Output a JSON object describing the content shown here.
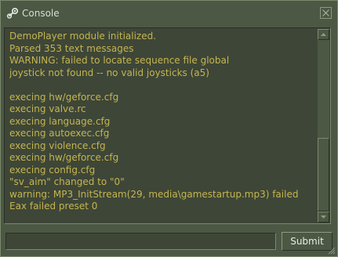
{
  "window": {
    "title": "Console",
    "title_icon": "steam-logo-icon",
    "close_icon": "close-icon"
  },
  "output": {
    "lines": [
      "DemoPlayer module initialized.",
      "Parsed 353 text messages",
      "WARNING: failed to locate sequence file global",
      "joystick not found -- no valid joysticks (a5)",
      "",
      "execing hw/geforce.cfg",
      "execing valve.rc",
      "execing language.cfg",
      "execing autoexec.cfg",
      "execing violence.cfg",
      "execing hw/geforce.cfg",
      "execing config.cfg",
      "\"sv_aim\" changed to \"0\"",
      "warning: MP3_InitStream(29, media\\gamestartup.mp3) failed",
      "Eax failed preset 0"
    ],
    "text_color": "#c4b550",
    "scroll_position": 1.0
  },
  "command": {
    "value": "",
    "placeholder": ""
  },
  "submit": {
    "label": "Submit"
  },
  "colors": {
    "window_bg": "#4c5844",
    "panel_bg": "#3e4637",
    "highlight": "#7b8a6e",
    "shadow": "#2a3024"
  }
}
